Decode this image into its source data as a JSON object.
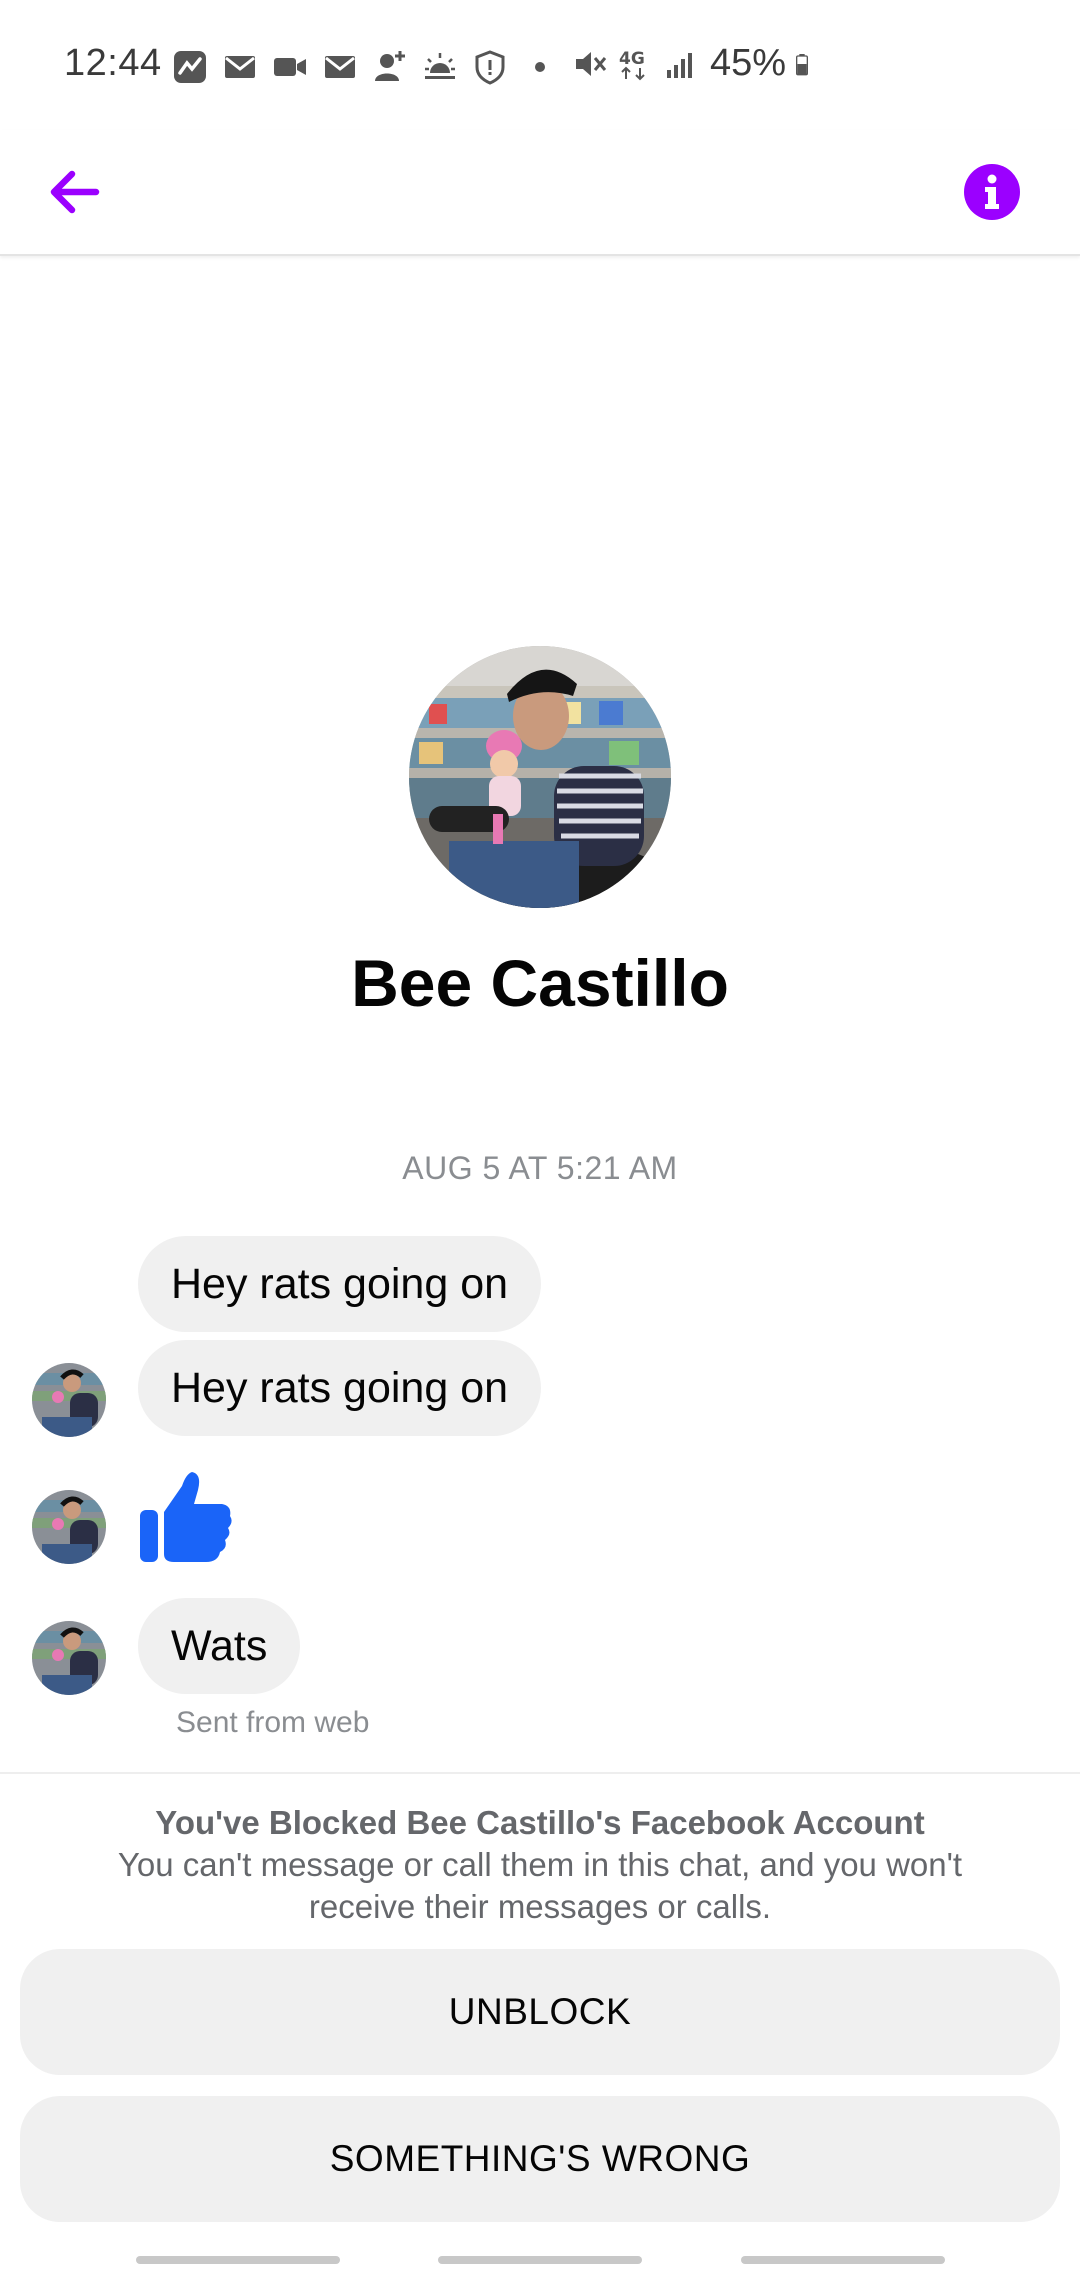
{
  "status_bar": {
    "time": "12:44",
    "battery_percent": "45%",
    "icons": [
      "stocks-app-icon",
      "gmail-icon",
      "video-call-icon",
      "gmail-icon",
      "add-contact-icon",
      "weather-icon",
      "shield-icon",
      "dot-icon",
      "mute-icon",
      "4g-lte-icon",
      "signal-icon",
      "battery-icon"
    ]
  },
  "app_bar": {
    "back_icon": "arrow-left-icon",
    "info_icon": "info-icon",
    "accent_color": "#9b00ff"
  },
  "profile": {
    "name": "Bee Castillo"
  },
  "conversation": {
    "timestamp": "AUG 5 AT 5:21 AM",
    "messages": [
      {
        "type": "text",
        "text": "Hey rats going on"
      },
      {
        "type": "text",
        "text": "Hey rats going on"
      },
      {
        "type": "like",
        "icon": "thumbs-up-icon",
        "color": "#1a64f8"
      },
      {
        "type": "text",
        "text": "Wats"
      }
    ],
    "sent_from": "Sent from web"
  },
  "blocked": {
    "title": "You've Blocked Bee Castillo's Facebook Account",
    "description": "You can't message or call them in this chat, and you won't receive their messages or calls.",
    "unblock_label": "UNBLOCK",
    "something_wrong_label": "SOMETHING'S WRONG"
  }
}
